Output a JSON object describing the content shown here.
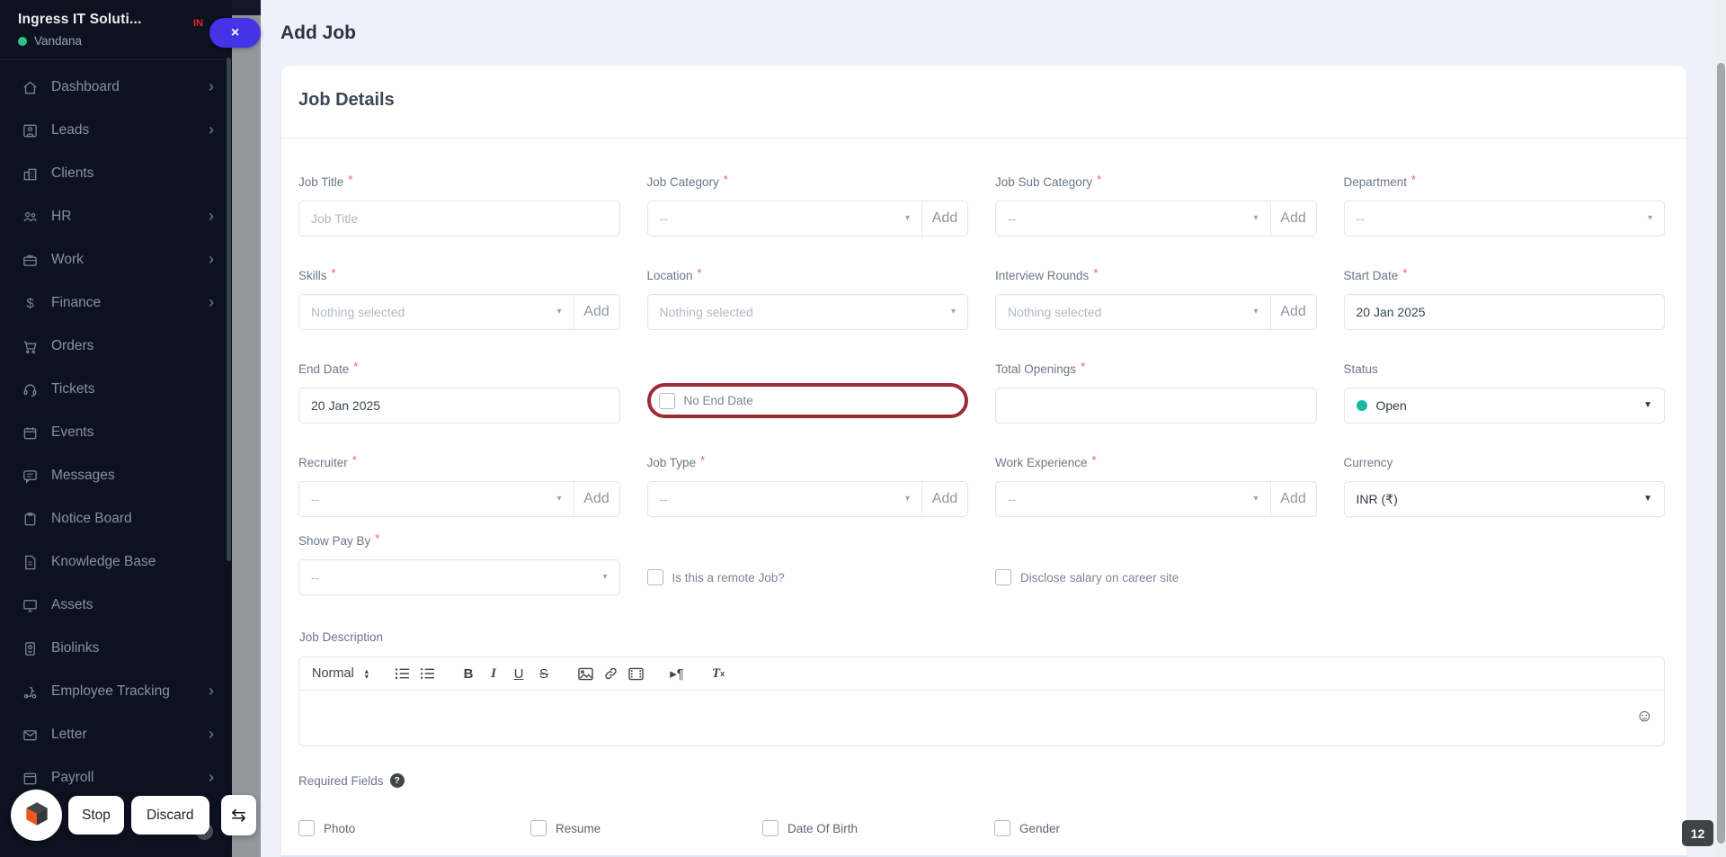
{
  "icons": {
    "close": "×",
    "chevron": "›",
    "caret": "▾",
    "caret_solid": "▼",
    "caret_up": "▴",
    "help": "?",
    "emoji": "☺",
    "swap": "⇆",
    "dollar": "$",
    "asterisk": "*",
    "paragraph": "▸¶"
  },
  "labels": {
    "add": "Add"
  },
  "sidebar": {
    "company": "Ingress IT Soluti...",
    "badge": "IN",
    "user": "Vandana",
    "items": [
      {
        "label": "Dashboard"
      },
      {
        "label": "Leads"
      },
      {
        "label": "Clients"
      },
      {
        "label": "HR"
      },
      {
        "label": "Work"
      },
      {
        "label": "Finance"
      },
      {
        "label": "Orders"
      },
      {
        "label": "Tickets"
      },
      {
        "label": "Events"
      },
      {
        "label": "Messages"
      },
      {
        "label": "Notice Board"
      },
      {
        "label": "Knowledge Base"
      },
      {
        "label": "Assets"
      },
      {
        "label": "Biolinks"
      },
      {
        "label": "Employee Tracking"
      },
      {
        "label": "Letter"
      },
      {
        "label": "Payroll"
      }
    ]
  },
  "header": {
    "title": "Add Job"
  },
  "card": {
    "title": "Job Details"
  },
  "fields": {
    "job_title": {
      "label": "Job Title",
      "placeholder": "Job Title"
    },
    "job_category": {
      "label": "Job Category",
      "value": "--"
    },
    "job_sub_category": {
      "label": "Job Sub Category",
      "value": "--"
    },
    "department": {
      "label": "Department",
      "value": "--"
    },
    "skills": {
      "label": "Skills",
      "value": "Nothing selected"
    },
    "location": {
      "label": "Location",
      "value": "Nothing selected"
    },
    "interview_rounds": {
      "label": "Interview Rounds",
      "value": "Nothing selected"
    },
    "start_date": {
      "label": "Start Date",
      "value": "20 Jan 2025"
    },
    "end_date": {
      "label": "End Date",
      "value": "20 Jan 2025"
    },
    "no_end_date": {
      "label": "No End Date"
    },
    "total_openings": {
      "label": "Total Openings",
      "value": ""
    },
    "status": {
      "label": "Status",
      "value": "Open"
    },
    "recruiter": {
      "label": "Recruiter",
      "value": "--"
    },
    "job_type": {
      "label": "Job Type",
      "value": "--"
    },
    "work_experience": {
      "label": "Work Experience",
      "value": "--"
    },
    "currency": {
      "label": "Currency",
      "value": "INR (₹)"
    },
    "show_pay_by": {
      "label": "Show Pay By",
      "value": "--"
    },
    "remote": {
      "label": "Is this a remote Job?"
    },
    "disclose_salary": {
      "label": "Disclose salary on career site"
    }
  },
  "editor": {
    "label": "Job Description",
    "format": "Normal",
    "bold": "B",
    "italic": "I",
    "underline": "U",
    "strike": "S",
    "clear_t": "T",
    "clear_x": "x"
  },
  "required_fields": {
    "label": "Required Fields",
    "options": [
      "Photo",
      "Resume",
      "Date Of Birth",
      "Gender"
    ]
  },
  "footer": {
    "stop": "Stop",
    "discard": "Discard",
    "badge_count": "12"
  },
  "colors": {
    "accent": "#4534e5",
    "highlight_red": "#9c2b35",
    "status_green": "#17b99a",
    "online_green": "#2bc48a",
    "badge_red": "#e8252a",
    "sidebar_bg": "#0d1220"
  }
}
